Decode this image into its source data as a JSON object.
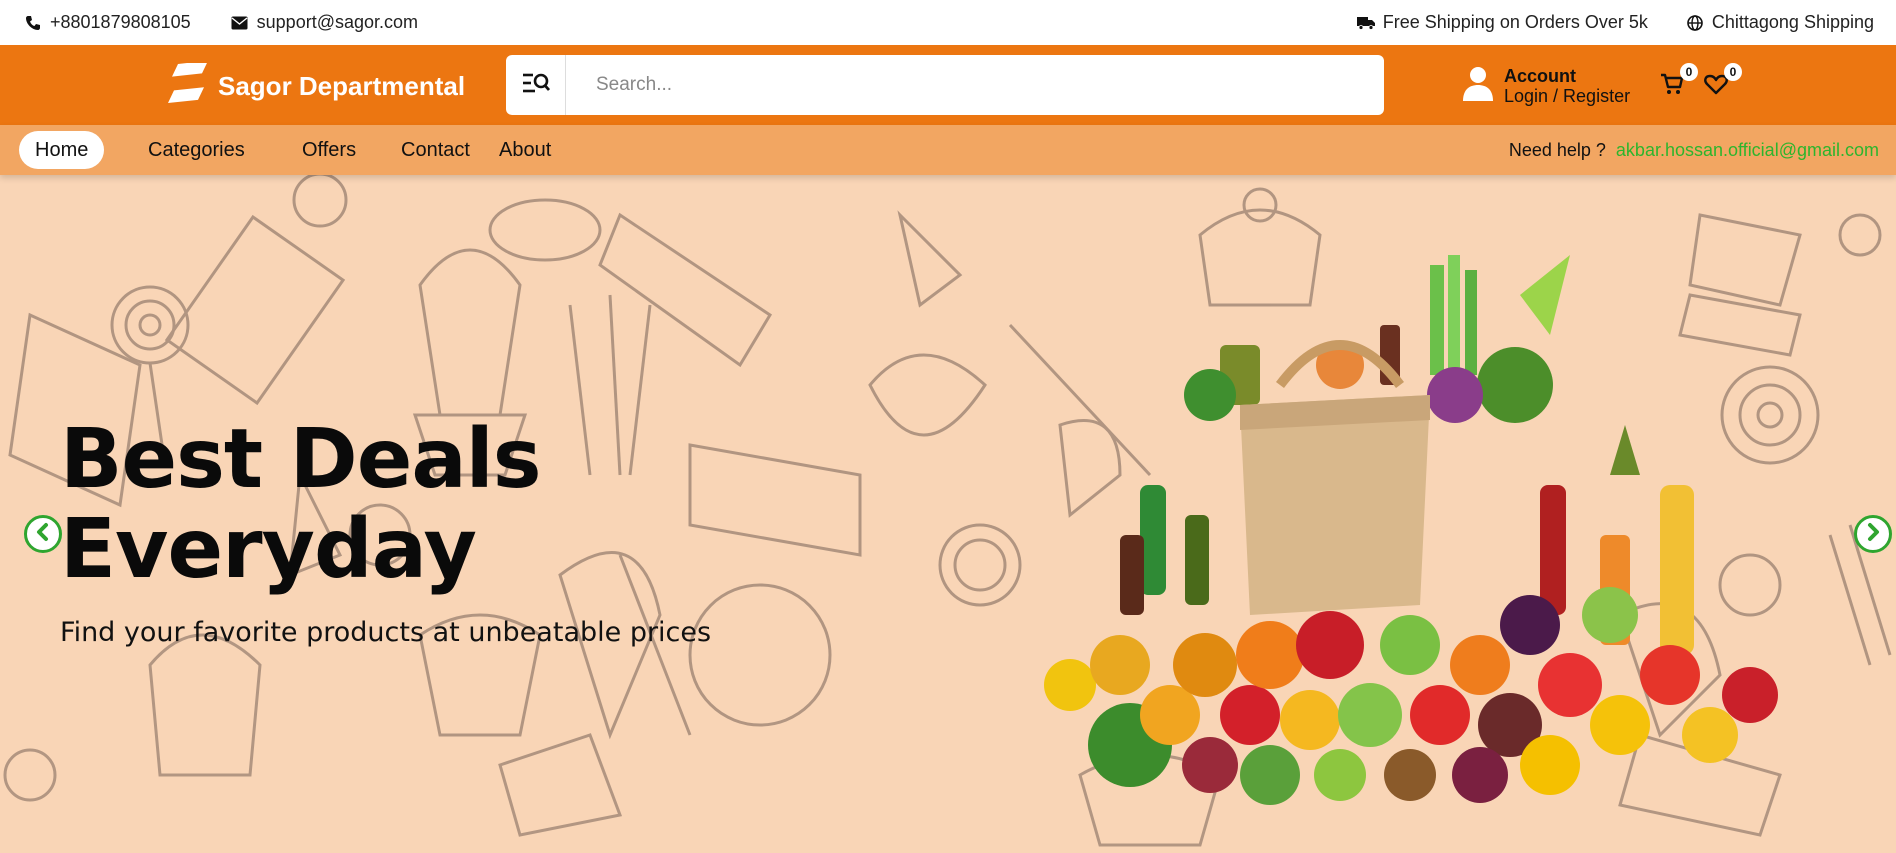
{
  "topbar": {
    "phone": "+8801879808105",
    "email": "support@sagor.com",
    "shipping_note": "Free Shipping on Orders Over 5k",
    "region": "Chittagong Shipping"
  },
  "header": {
    "brand": "Sagor Departmental",
    "search_placeholder": "Search...",
    "account_title": "Account",
    "account_sub": "Login / Register",
    "cart_count": "0",
    "wishlist_count": "0"
  },
  "nav": {
    "items": [
      "Home",
      "Categories",
      "Offers",
      "Contact",
      "About"
    ],
    "help_label": "Need help ?",
    "help_email": "akbar.hossan.official@gmail.com"
  },
  "hero": {
    "title_line1": "Best Deals",
    "title_line2": "Everyday",
    "subtitle": "Find your favorite products at unbeatable prices"
  },
  "colors": {
    "header_bg": "#ec7611",
    "nav_bg": "#f2a662",
    "hero_bg": "#f9d5b6",
    "help_email": "#2db52d",
    "arrow": "#2fa52f"
  }
}
